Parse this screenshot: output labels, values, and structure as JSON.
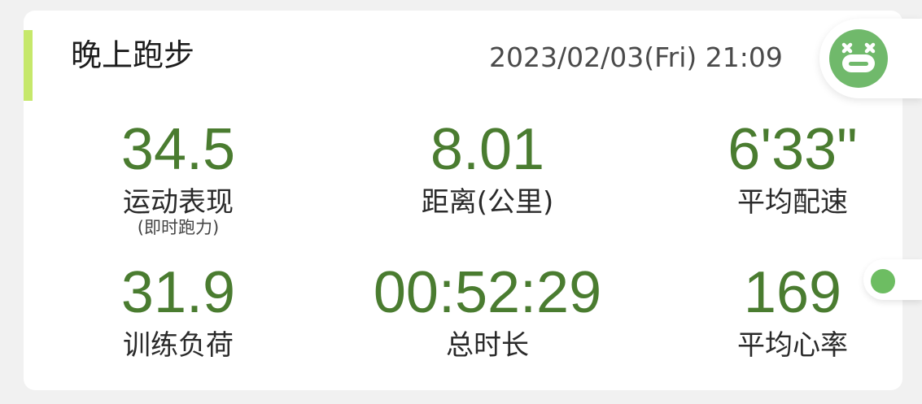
{
  "header": {
    "title": "晚上跑步",
    "datetime": "2023/02/03(Fri) 21:09"
  },
  "avatar": {
    "icon": "mascot-face-icon",
    "color": "#70b96b"
  },
  "side_dot": {
    "color": "#6dbd62"
  },
  "colors": {
    "accent_bar": "#c6e86b",
    "value_text": "#4a7c30"
  },
  "stats": [
    {
      "value": "34.5",
      "label": "运动表现",
      "sublabel": "(即时跑力)"
    },
    {
      "value": "8.01",
      "label": "距离(公里)"
    },
    {
      "value": "6'33\"",
      "label": "平均配速"
    },
    {
      "value": "31.9",
      "label": "训练负荷"
    },
    {
      "value": "00:52:29",
      "label": "总时长"
    },
    {
      "value": "169",
      "label": "平均心率"
    }
  ]
}
